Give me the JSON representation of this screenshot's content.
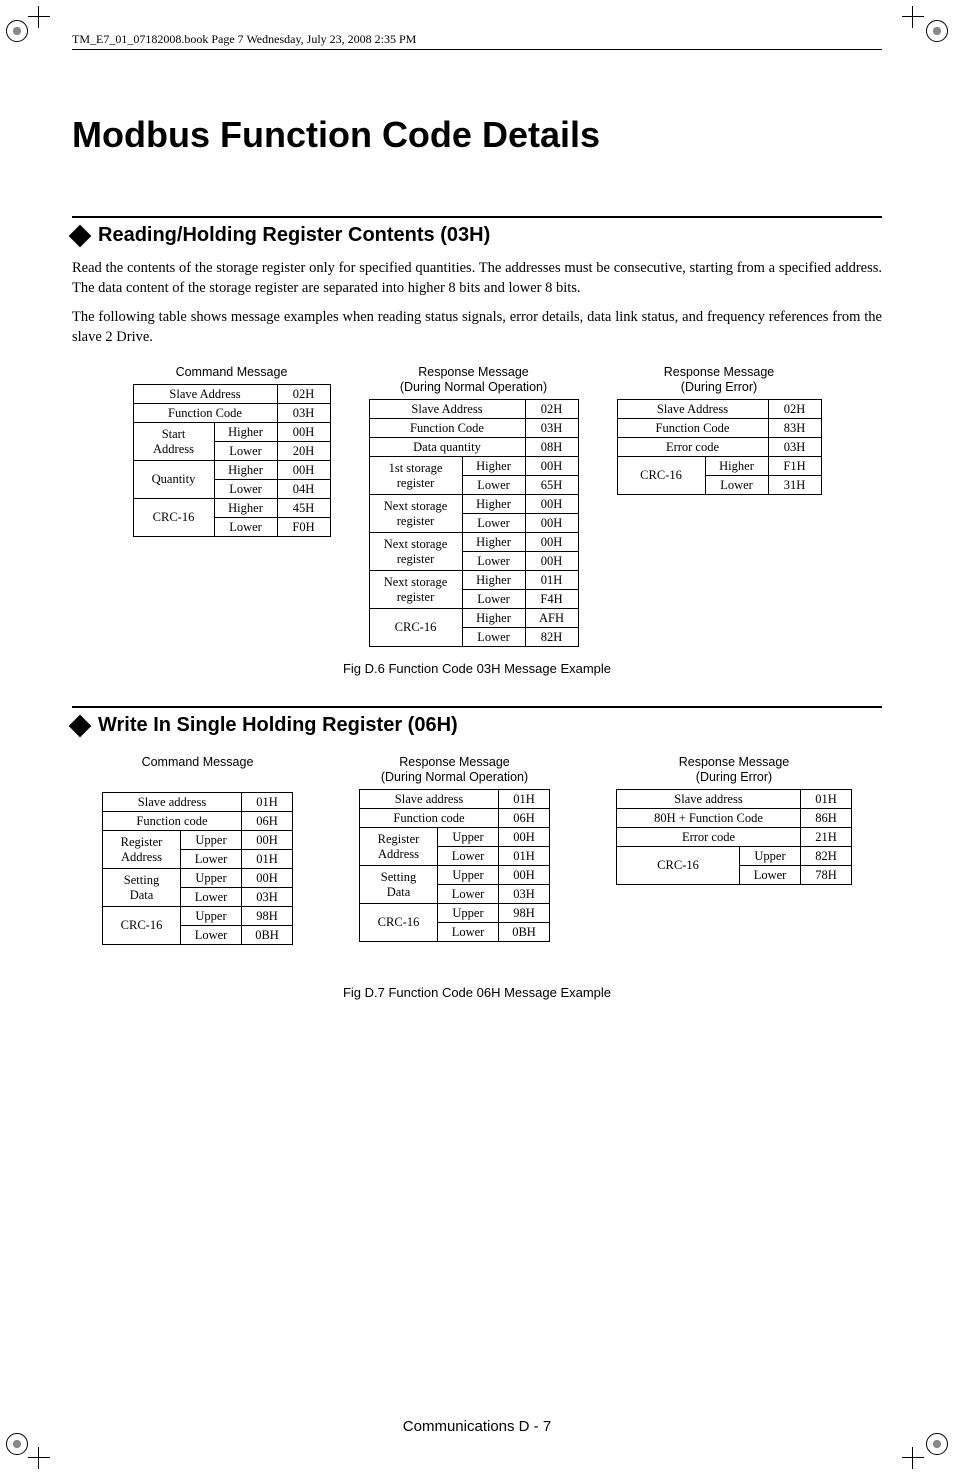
{
  "header_note": "TM_E7_01_07182008.book  Page 7  Wednesday, July 23, 2008  2:35 PM",
  "main_title": "Modbus Function Code Details",
  "section1": {
    "title": "Reading/Holding Register Contents (03H)",
    "para1": "Read the contents of the storage register only for specified quantities. The addresses must be consecutive, starting from a specified address. The data content of the storage register are separated into higher 8 bits and lower 8 bits.",
    "para2": "The following table shows message examples when reading status signals, error details, data link status, and frequency references from the slave 2 Drive."
  },
  "captions": {
    "cmd": "Command Message",
    "resp_normal_l1": "Response Message",
    "resp_normal_l2": "(During Normal Operation)",
    "resp_error_l1": "Response Message",
    "resp_error_l2": "(During Error)"
  },
  "fig1_caption": "Fig D.6  Function Code 03H Message Example",
  "section2": {
    "title": "Write In Single Holding Register (06H)"
  },
  "fig2_caption": "Fig D.7  Function Code 06H Message Example",
  "footer": "Communications   D - 7",
  "tables": {
    "s1_cmd": [
      [
        "Slave Address",
        "",
        "02H"
      ],
      [
        "Function Code",
        "",
        "03H"
      ],
      [
        "Start",
        "Higher",
        "00H"
      ],
      [
        "Address",
        "Lower",
        "20H"
      ],
      [
        "Quantity",
        "Higher",
        "00H"
      ],
      [
        "",
        "Lower",
        "04H"
      ],
      [
        "CRC-16",
        "Higher",
        "45H"
      ],
      [
        "",
        "Lower",
        "F0H"
      ]
    ],
    "s1_resp_normal": [
      [
        "Slave Address",
        "",
        "02H"
      ],
      [
        "Function Code",
        "",
        "03H"
      ],
      [
        "Data quantity",
        "",
        "08H"
      ],
      [
        "1st storage",
        "Higher",
        "00H"
      ],
      [
        "register",
        "Lower",
        "65H"
      ],
      [
        "Next storage",
        "Higher",
        "00H"
      ],
      [
        "register",
        "Lower",
        "00H"
      ],
      [
        "Next storage",
        "Higher",
        "00H"
      ],
      [
        "register",
        "Lower",
        "00H"
      ],
      [
        "Next storage",
        "Higher",
        "01H"
      ],
      [
        "register",
        "Lower",
        "F4H"
      ],
      [
        "CRC-16",
        "Higher",
        "AFH"
      ],
      [
        "",
        "Lower",
        "82H"
      ]
    ],
    "s1_resp_error": [
      [
        "Slave Address",
        "",
        "02H"
      ],
      [
        "Function Code",
        "",
        "83H"
      ],
      [
        "Error code",
        "",
        "03H"
      ],
      [
        "CRC-16",
        "Higher",
        "F1H"
      ],
      [
        "",
        "Lower",
        "31H"
      ]
    ],
    "s2_cmd": [
      [
        "Slave address",
        "",
        "01H"
      ],
      [
        "Function code",
        "",
        "06H"
      ],
      [
        "Register",
        "Upper",
        "00H"
      ],
      [
        "Address",
        "Lower",
        "01H"
      ],
      [
        "Setting",
        "Upper",
        "00H"
      ],
      [
        "Data",
        "Lower",
        "03H"
      ],
      [
        "CRC-16",
        "Upper",
        "98H"
      ],
      [
        "",
        "Lower",
        "0BH"
      ]
    ],
    "s2_resp_normal": [
      [
        "Slave address",
        "",
        "01H"
      ],
      [
        "Function code",
        "",
        "06H"
      ],
      [
        "Register",
        "Upper",
        "00H"
      ],
      [
        "Address",
        "Lower",
        "01H"
      ],
      [
        "Setting",
        "Upper",
        "00H"
      ],
      [
        "Data",
        "Lower",
        "03H"
      ],
      [
        "CRC-16",
        "Upper",
        "98H"
      ],
      [
        "",
        "Lower",
        "0BH"
      ]
    ],
    "s2_resp_error": [
      [
        "Slave address",
        "",
        "01H"
      ],
      [
        "80H + Function Code",
        "",
        "86H"
      ],
      [
        "Error code",
        "",
        "21H"
      ],
      [
        "CRC-16",
        "Upper",
        "82H"
      ],
      [
        "",
        "Lower",
        "78H"
      ]
    ]
  }
}
